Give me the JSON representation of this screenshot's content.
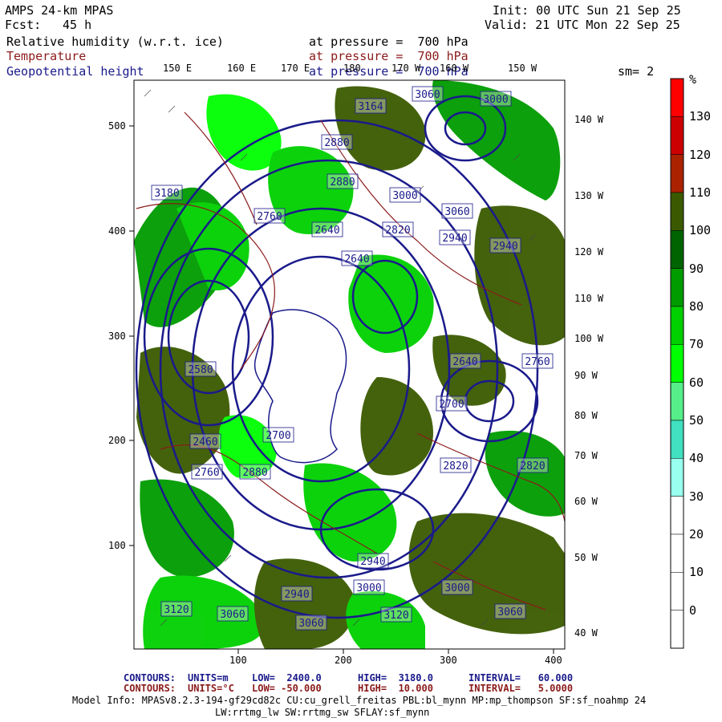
{
  "header": {
    "title": "AMPS 24-km MPAS",
    "forecast_label": "Fcst:",
    "forecast_value": "45 h",
    "init": "Init: 00 UTC Sun 21 Sep 25",
    "valid": "Valid: 21 UTC Mon 22 Sep 25",
    "smoothing": "sm= 2"
  },
  "fields": [
    {
      "name": "Relative humidity (w.r.t. ice)",
      "level": "at pressure =  700 hPa",
      "color": "#000000"
    },
    {
      "name": "Temperature",
      "level": "at pressure =  700 hPa",
      "color": "#8b1a1a"
    },
    {
      "name": "Geopotential height",
      "level": "at pressure =  700 hPa",
      "color": "#1a1a8b"
    }
  ],
  "axes": {
    "x_ticks": [
      "100",
      "200",
      "300",
      "400"
    ],
    "y_ticks": [
      "500",
      "400",
      "300",
      "200",
      "100"
    ],
    "top_lon": [
      "150 E",
      "160 E",
      "170 E",
      "180",
      "170 W",
      "160 W",
      "150 W"
    ],
    "right_lon": [
      "140 W",
      "130 W",
      "120 W",
      "110 W",
      "100 W",
      "90 W",
      "80 W",
      "70 W",
      "60 W",
      "50 W",
      "40 W"
    ]
  },
  "colorbar": {
    "unit": "%",
    "labels": [
      "130",
      "120",
      "110",
      "100",
      "90",
      "80",
      "70",
      "60",
      "50",
      "40",
      "30",
      "20",
      "10",
      "0"
    ],
    "colors": [
      "#ff0000",
      "#cc0000",
      "#aa2200",
      "#3b5a00",
      "#006400",
      "#009b00",
      "#00d000",
      "#00ff00",
      "#55ee88",
      "#40e0c0",
      "#99ffee",
      "#ffffff",
      "#ffffff",
      "#ffffff",
      "#ffffff"
    ]
  },
  "contour_labels": [
    "3164",
    "3060",
    "3000",
    "2880",
    "3000",
    "3060",
    "3180",
    "2880",
    "2760",
    "2640",
    "2820",
    "2940",
    "2940",
    "2640",
    "2580",
    "2640",
    "2760",
    "2700",
    "2460",
    "2700",
    "2760",
    "2880",
    "2820",
    "2820",
    "2940",
    "3000",
    "3000",
    "3120",
    "3060",
    "3060",
    "3120",
    "2940",
    "3060"
  ],
  "footer": {
    "line1_label": "CONTOURS:",
    "line1_units": "UNITS=m",
    "line1_low": "LOW=  2400.0",
    "line1_high": "HIGH=  3180.0",
    "line1_int": "INTERVAL=   60.000",
    "line2_label": "CONTOURS:",
    "line2_units": "UNITS=°C",
    "line2_low": "LOW= -50.000",
    "line2_high": "HIGH=  10.000",
    "line2_int": "INTERVAL=   5.0000",
    "model_info": "Model Info: MPASv8.2.3-194-gf29cd82c CU:cu_grell_freitas PBL:bl_mynn MP:mp_thompson SF:sf_noahmp 24",
    "model_info2": "LW:rrtmg_lw SW:rrtmg_sw SFLAY:sf_mynn"
  }
}
